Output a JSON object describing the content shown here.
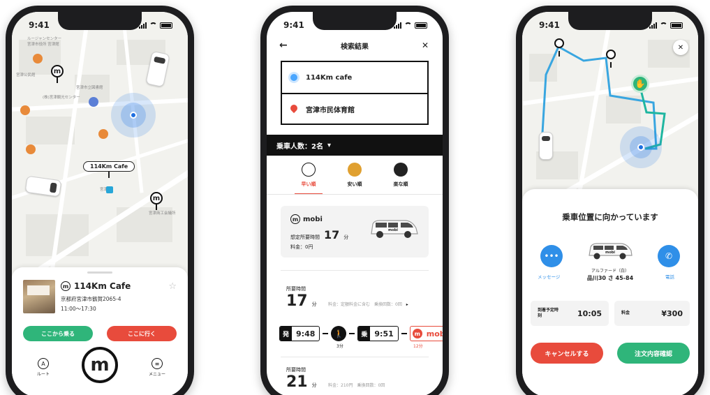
{
  "status_time": "9:41",
  "colors": {
    "accent_red": "#e84b3c",
    "accent_green": "#2fb57a",
    "route_blue": "#39a6e0",
    "route_green": "#1fb6a0",
    "user_blue": "#1f6fe0"
  },
  "phone1": {
    "map": {
      "labels": [
        "ルージャンセンター",
        "宮津市役所 宮津館",
        "宮津公民館",
        "(株)宮津観光センター",
        "宮津市立図書館",
        "宮津商工会議所",
        "宮津駅"
      ],
      "callout": "114Km Cafe"
    },
    "place": {
      "name": "114Km Cafe",
      "address": "京都府宮津市鶴賀2065-4",
      "hours": "11:00〜17:30",
      "star_icon": "star-icon"
    },
    "buttons": {
      "board_here": "ここから乗る",
      "go_here": "ここに行く"
    },
    "tabs": {
      "route_label": "ルート",
      "route_icon": "A",
      "menu_label": "メニュー",
      "menu_icon": "≡",
      "center_logo": "m"
    }
  },
  "phone2": {
    "header": {
      "title": "検索結果",
      "back": "←",
      "close": "✕"
    },
    "origin": "114Km cafe",
    "destination": "宮津市民体育館",
    "passengers": "乗車人数：2名",
    "passengers_caret": "▾",
    "sort_tabs": [
      {
        "label": "早い順",
        "active": true
      },
      {
        "label": "安い順",
        "active": false
      },
      {
        "label": "楽な順",
        "active": false
      }
    ],
    "mobi_card": {
      "brand": "mobi",
      "duration_label": "想定所要時間",
      "duration_value": "17",
      "duration_unit": "分",
      "fare": "料金：0円",
      "vehicle_badge": "mobi"
    },
    "results": [
      {
        "label": "所要時間",
        "minutes": "17",
        "unit": "分",
        "meta": "料金：定額料金に含む　乗換回数：0回",
        "meta_caret": "▸",
        "steps": {
          "depart_tag": "発",
          "depart_time": "9:48",
          "walk_icon": "🚶",
          "walk_min": "3分",
          "board_tag": "乗",
          "board_time": "9:51",
          "mobi_tag": "m",
          "mobi_text": "mobi",
          "mobi_min": "12分"
        }
      },
      {
        "label": "所要時間",
        "minutes": "21",
        "unit": "分",
        "meta": "料金：210円　乗換回数：0回"
      }
    ]
  },
  "phone3": {
    "close": "✕",
    "status_title": "乗車位置に向かっています",
    "message_label": "メッセージ",
    "call_label": "電話",
    "vehicle_badge": "mobi",
    "vehicle_model": "アルファード（白）",
    "plate": "品川30 さ 45-84",
    "eta_label": "到着予定時刻",
    "eta_value": "10:05",
    "fare_label": "料金",
    "fare_value": "¥300",
    "cancel_button": "キャンセルする",
    "order_button": "注文内容確認"
  }
}
